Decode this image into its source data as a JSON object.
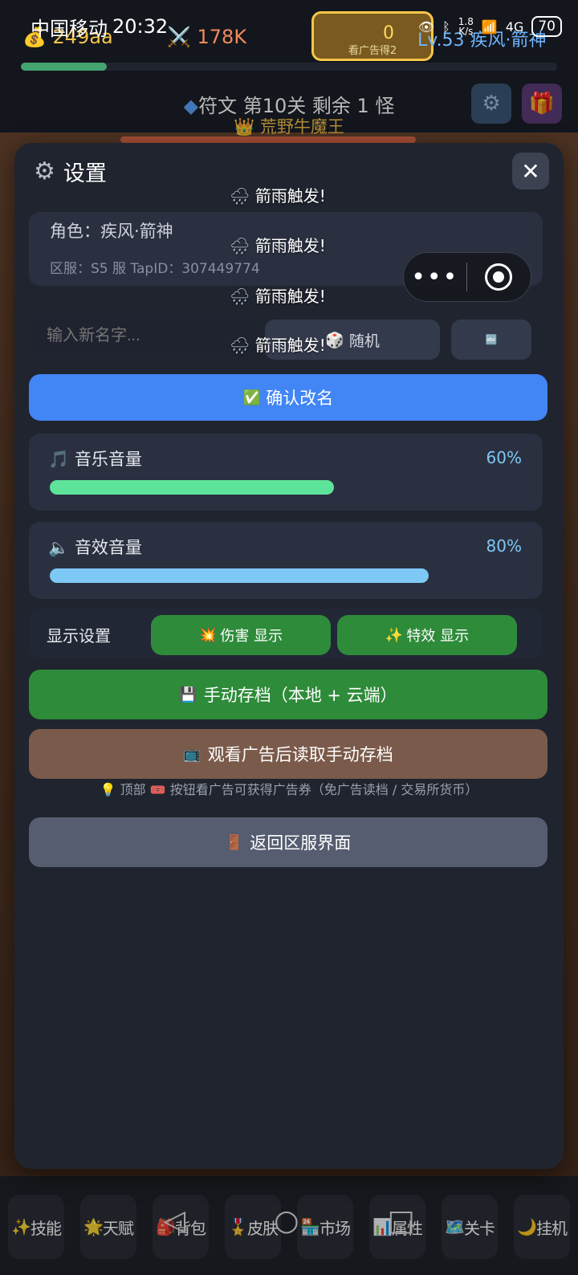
{
  "status_bar": {
    "carrier": "中国移动",
    "time": "20:32",
    "net_speed_value": "1.8",
    "net_speed_unit": "K/s",
    "network": "4G",
    "battery": "70"
  },
  "hud": {
    "gold": "249aa",
    "attack": "178K",
    "ad_tickets": "0",
    "ad_label": "看广告得2",
    "level_name": "Lv.53 疾风·箭神",
    "xp_fraction": 0.16,
    "stage": "符文 第10关  剩余 1 怪",
    "boss": "荒野牛魔王"
  },
  "settings": {
    "title": "设置",
    "role_label": "角色：疾风·箭神",
    "server_label": "区服：S5 服   TapID：307449774",
    "name_placeholder": "输入新名字...",
    "random_label": "随机",
    "confirm_label": "确认改名",
    "float_text": "箭雨触发!",
    "music": {
      "label": "音乐音量",
      "percent_text": "60%",
      "value": 0.6,
      "color": "#5ee39a"
    },
    "sfx": {
      "label": "音效音量",
      "percent_text": "80%",
      "value": 0.8,
      "color": "#7ec8f5"
    },
    "display_label": "显示设置",
    "damage_toggle": "伤害 显示",
    "effects_toggle": "特效 显示",
    "save_label": "手动存档（本地 + 云端）",
    "load_label": "观看广告后读取手动存档",
    "tip": "顶部 🎟️ 按钮看广告可获得广告券（免广告读档 / 交易所货币）",
    "back_label": "返回区服界面"
  },
  "bottom_nav": [
    {
      "icon": "✨",
      "label": "技能"
    },
    {
      "icon": "🌟",
      "label": "天赋"
    },
    {
      "icon": "🎒",
      "label": "背包"
    },
    {
      "icon": "🎖️",
      "label": "皮肤"
    },
    {
      "icon": "🏪",
      "label": "市场"
    },
    {
      "icon": "📊",
      "label": "属性"
    },
    {
      "icon": "🗺️",
      "label": "关卡"
    },
    {
      "icon": "🌙",
      "label": "挂机"
    }
  ]
}
